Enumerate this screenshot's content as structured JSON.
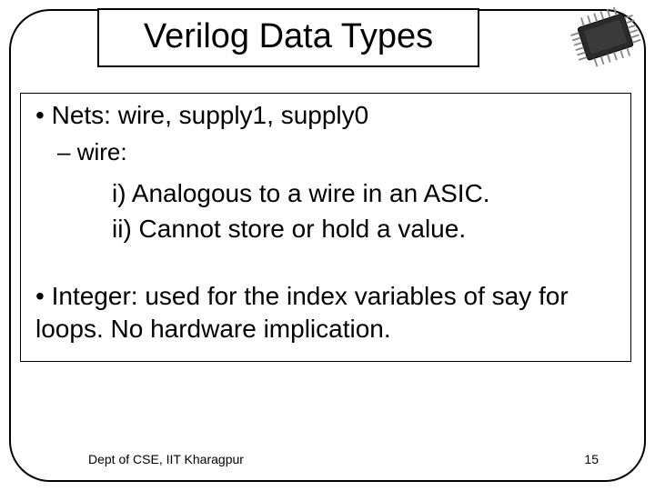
{
  "title": "Verilog Data Types",
  "bullets": {
    "nets": "Nets: wire, supply1, supply0",
    "wire_sub": "wire:",
    "wire_i": "i) Analogous to a wire in an ASIC.",
    "wire_ii": "ii) Cannot store or hold a value.",
    "integer": "Integer: used for the index variables of say for loops. No hardware implication."
  },
  "footer": {
    "dept": "Dept of CSE, IIT Kharagpur",
    "page": "15"
  },
  "icon": "chip-icon"
}
